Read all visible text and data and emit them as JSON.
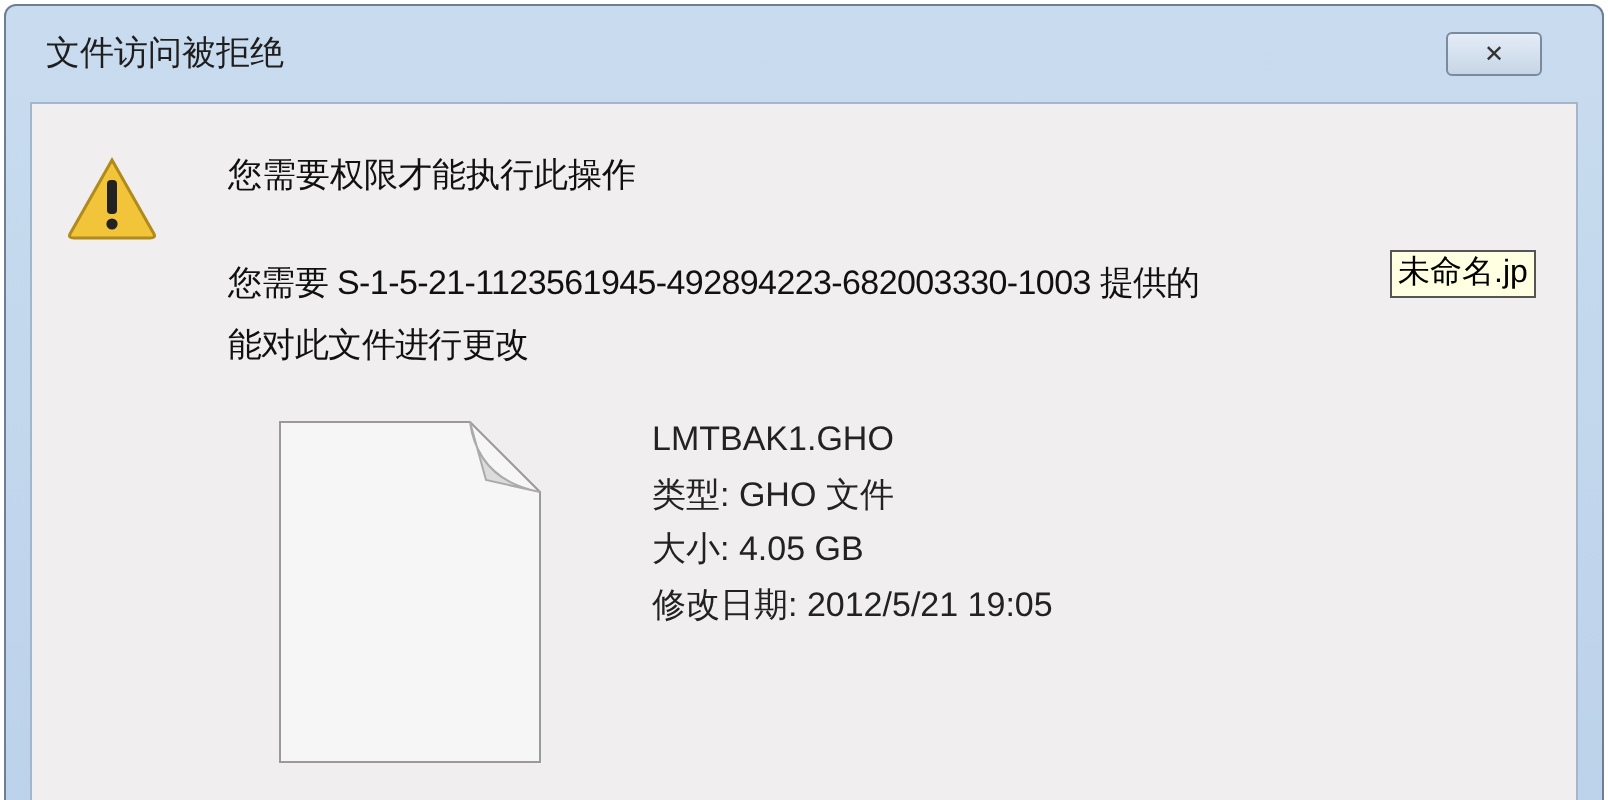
{
  "window": {
    "title": "文件访问被拒绝",
    "close": "✕"
  },
  "heading": "您需要权限才能执行此操作",
  "message_lines": [
    "您需要 S-1-5-21-1123561945-492894223-682003330-1003 提供的",
    "能对此文件进行更改"
  ],
  "tooltip": "未命名.jp",
  "file": {
    "name": "LMTBAK1.GHO",
    "details": [
      "类型: GHO 文件",
      "大小: 4.05 GB",
      "修改日期: 2012/5/21 19:05"
    ]
  }
}
